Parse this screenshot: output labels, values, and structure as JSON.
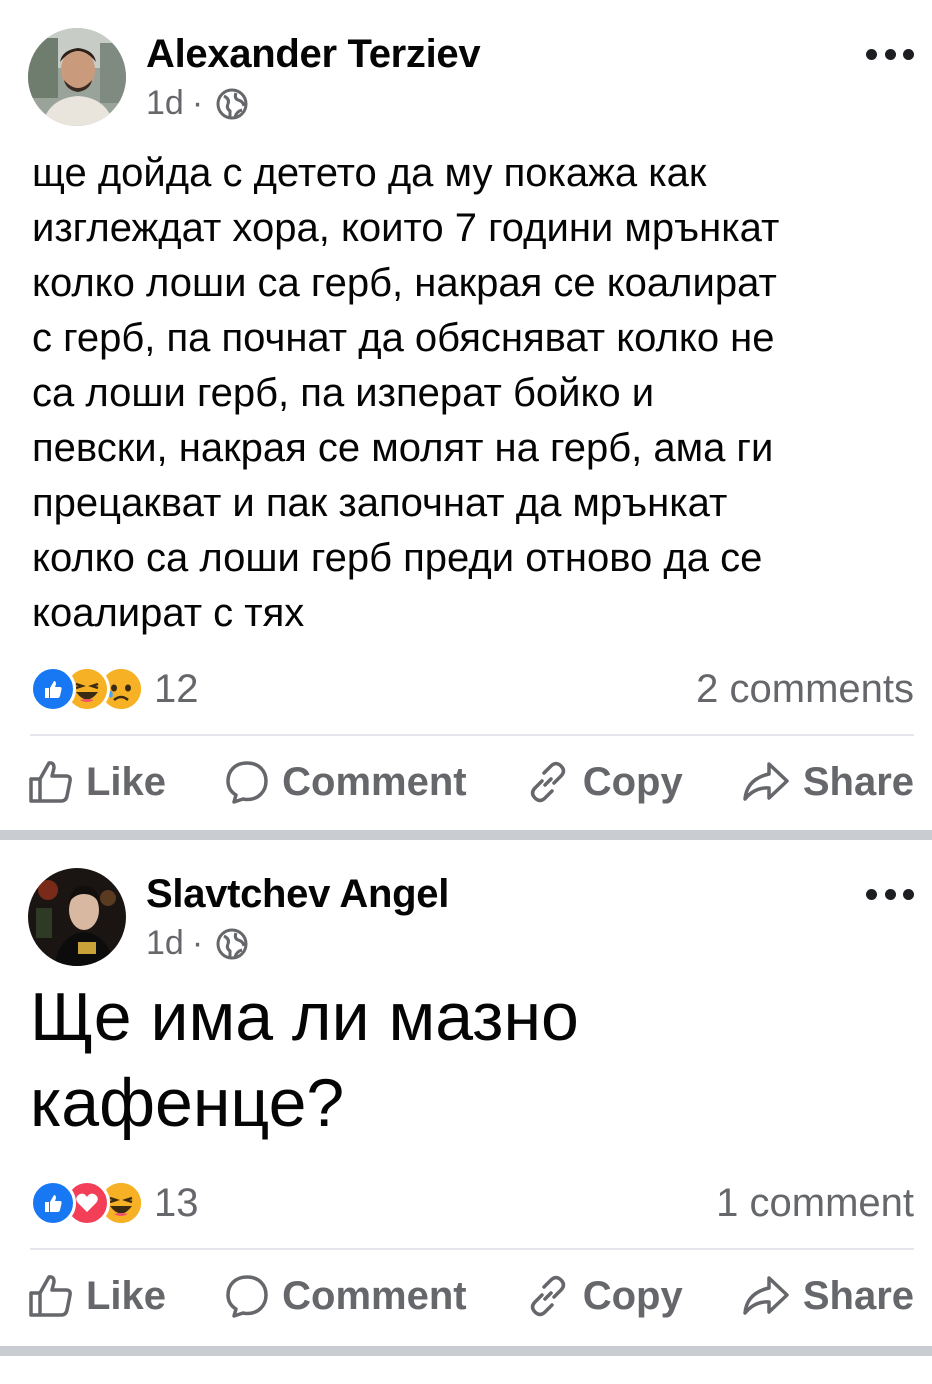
{
  "posts": [
    {
      "author": "Alexander Terziev",
      "time": "1d",
      "dot": "·",
      "text_lines": [
        "ще дойда с детето да му покажа как",
        "изглеждат хора, които 7 години мрънкат",
        "колко лоши са герб, накрая се коалират",
        "с герб, па почнат да обясняват колко не",
        "са лоши герб, па изперат бойко и",
        "певски, накрая се молят на герб, ама ги",
        "прецакват и пак започнат да мрънкат",
        "колко са лоши герб преди отново да се",
        "коалират с тях"
      ],
      "reactions": [
        "like",
        "haha",
        "sad"
      ],
      "reaction_count": "12",
      "comments": "2 comments"
    },
    {
      "author": "Slavtchev Angel",
      "time": "1d",
      "dot": "·",
      "text_lines": [
        "Ще има ли мазно",
        "кафенце?"
      ],
      "reactions": [
        "like",
        "love",
        "haha"
      ],
      "reaction_count": "13",
      "comments": "1 comment"
    }
  ],
  "actions": {
    "like": "Like",
    "comment": "Comment",
    "copy": "Copy",
    "share": "Share"
  },
  "colors": {
    "like_blue": "#1877f2",
    "love_red": "#f33e58",
    "haha_yellow": "#f7b125",
    "muted_text": "#65676b"
  }
}
